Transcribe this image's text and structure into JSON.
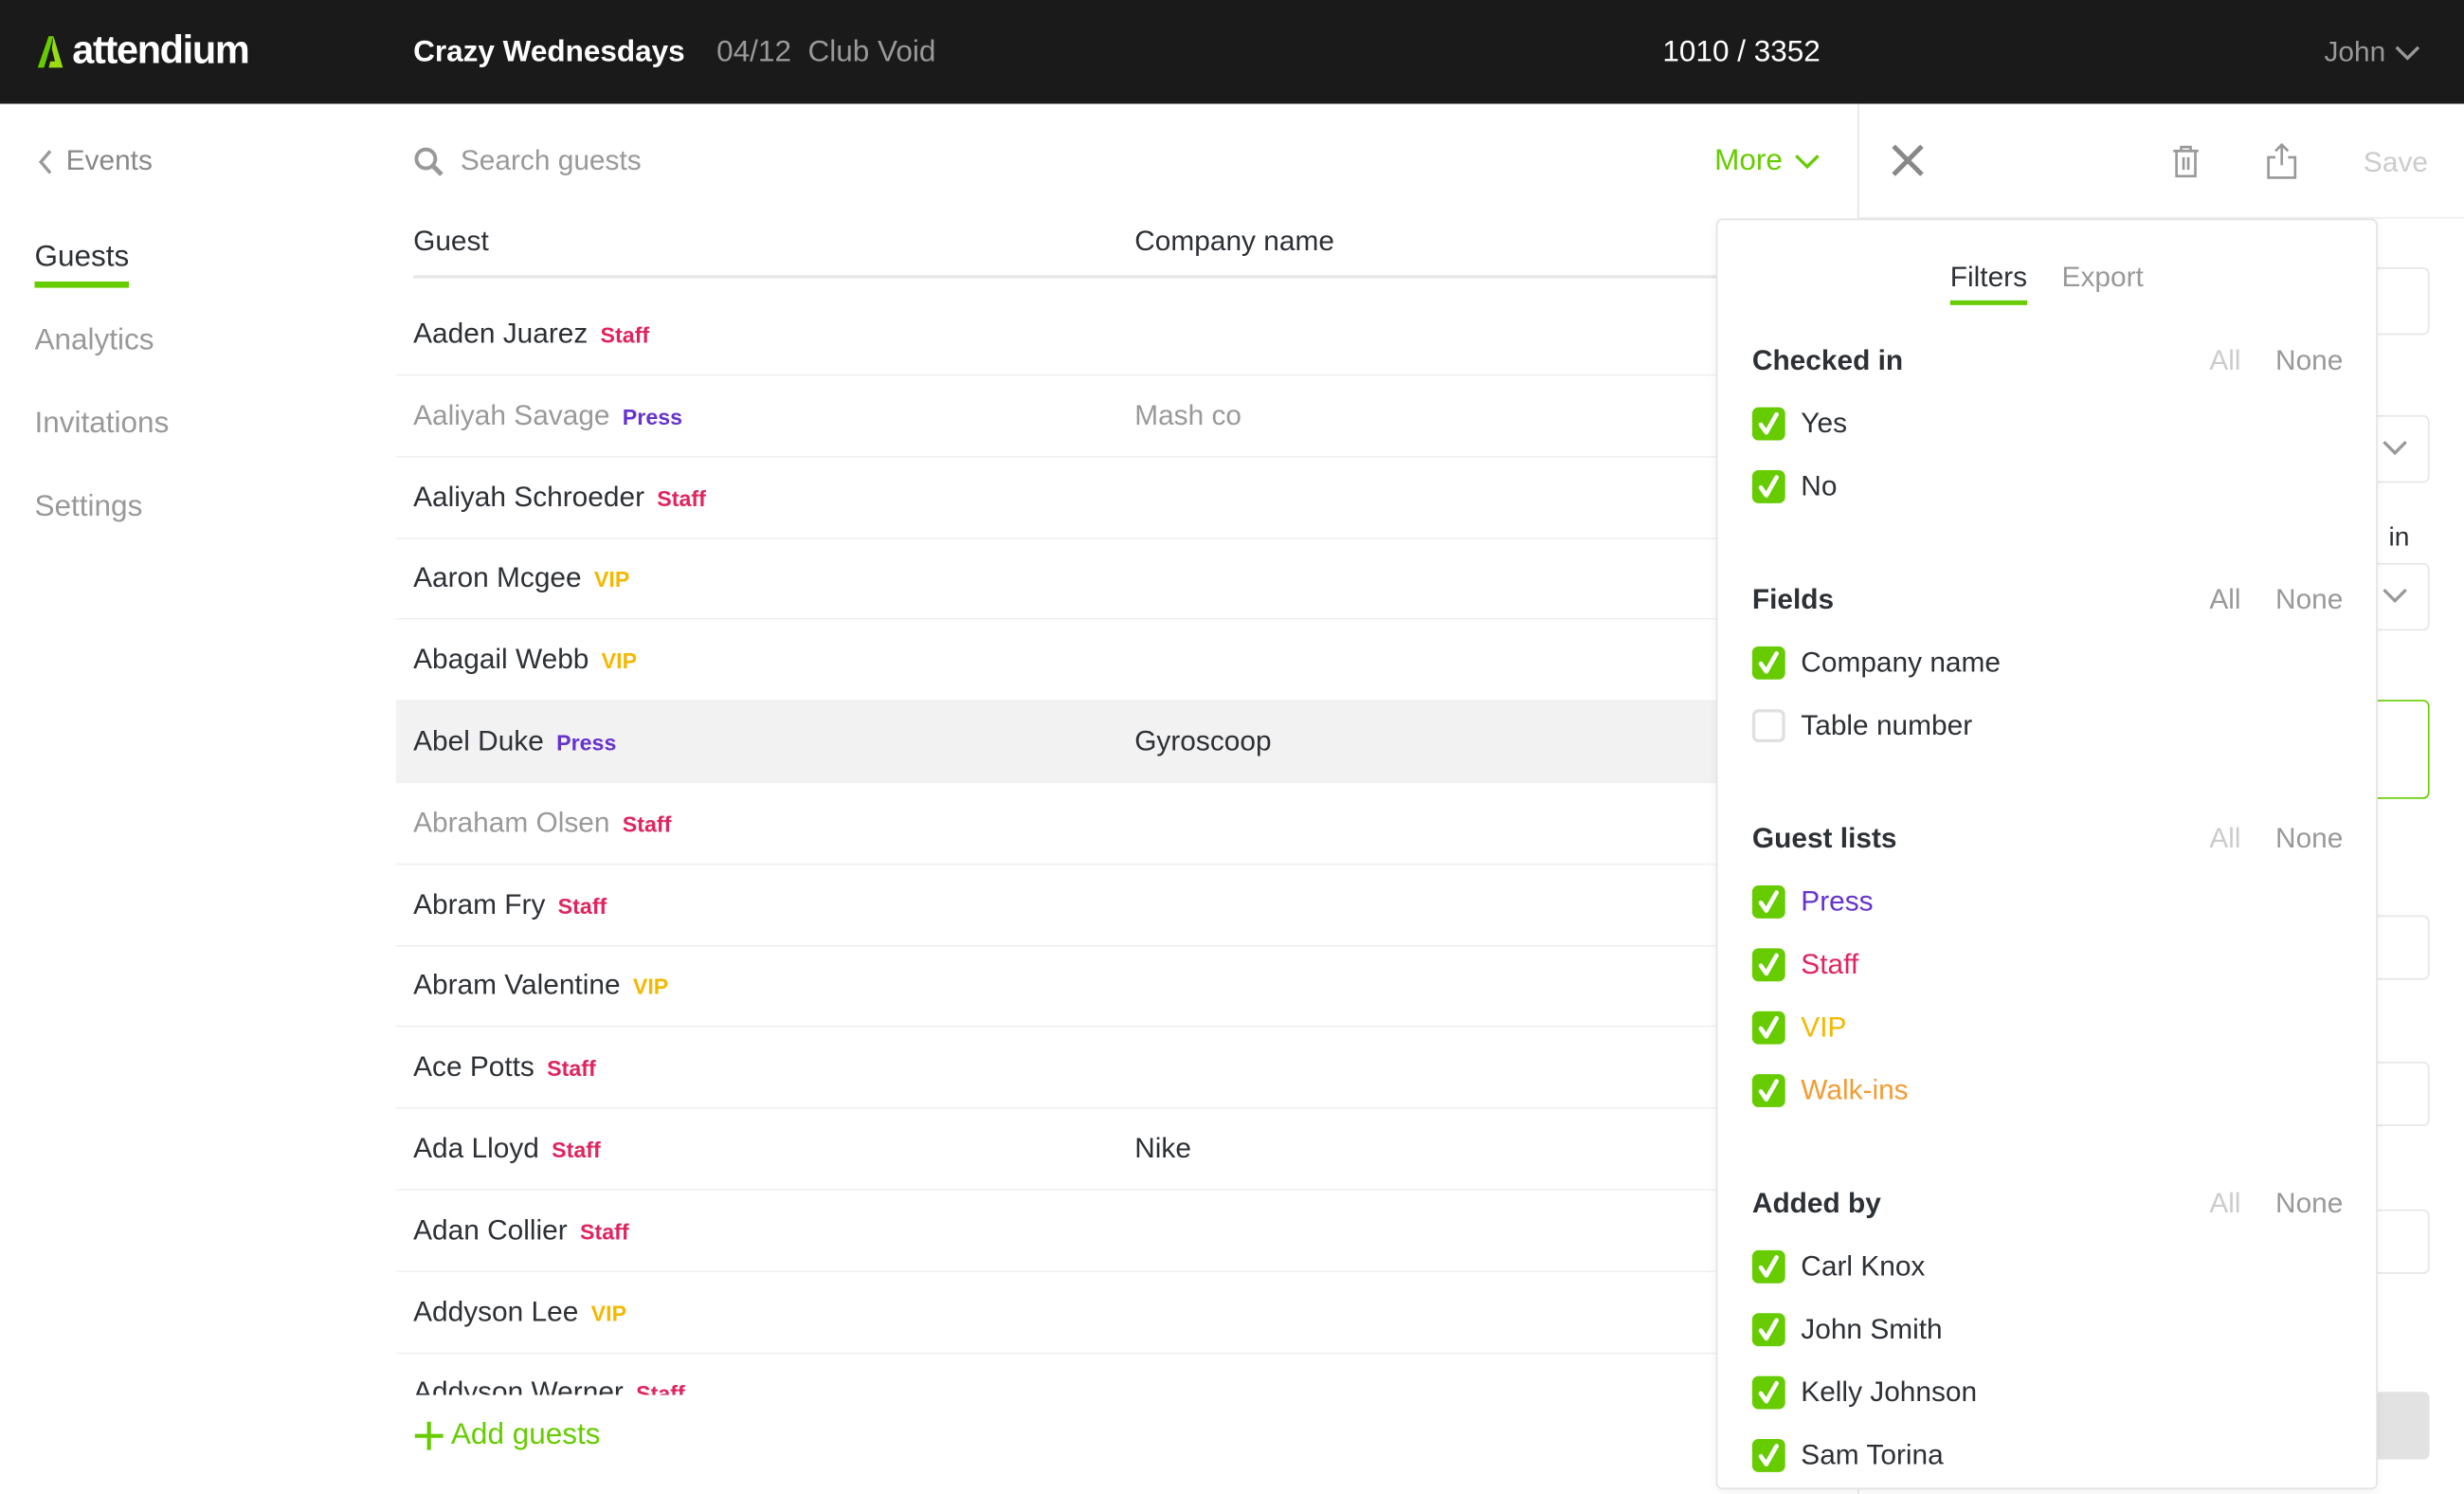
{
  "header": {
    "logo": "attendium",
    "event_name": "Crazy Wednesdays",
    "event_date": "04/12",
    "venue": "Club Void",
    "count": "1010 / 3352",
    "user": "John"
  },
  "sidebar": {
    "back": "Events",
    "items": [
      {
        "label": "Guests",
        "active": true
      },
      {
        "label": "Analytics"
      },
      {
        "label": "Invitations"
      },
      {
        "label": "Settings"
      }
    ]
  },
  "search": {
    "placeholder": "Search guests"
  },
  "more_label": "More",
  "columns": [
    "Guest",
    "Company name"
  ],
  "tag_colors": {
    "Staff": "#e0245e",
    "Press": "#6633cc",
    "VIP": "#f5b800",
    "Walk-ins": "#f39c33"
  },
  "accent": "#66cc00",
  "guests": [
    {
      "name": "Aaden Juarez",
      "tag": "Staff",
      "company": ""
    },
    {
      "name": "Aaliyah Savage",
      "tag": "Press",
      "company": "Mash co",
      "dim": true
    },
    {
      "name": "Aaliyah Schroeder",
      "tag": "Staff",
      "company": ""
    },
    {
      "name": "Aaron Mcgee",
      "tag": "VIP",
      "company": ""
    },
    {
      "name": "Abagail Webb",
      "tag": "VIP",
      "company": ""
    },
    {
      "name": "Abel Duke",
      "tag": "Press",
      "company": "Gyroscoop",
      "highlighted": true
    },
    {
      "name": "Abraham Olsen",
      "tag": "Staff",
      "company": "",
      "dim": true
    },
    {
      "name": "Abram Fry",
      "tag": "Staff",
      "company": ""
    },
    {
      "name": "Abram Valentine",
      "tag": "VIP",
      "company": ""
    },
    {
      "name": "Ace Potts",
      "tag": "Staff",
      "company": ""
    },
    {
      "name": "Ada Lloyd",
      "tag": "Staff",
      "company": "Nike"
    },
    {
      "name": "Adan Collier",
      "tag": "Staff",
      "company": ""
    },
    {
      "name": "Addyson Lee",
      "tag": "VIP",
      "company": ""
    },
    {
      "name": "Addyson Werner",
      "tag": "Staff",
      "company": ""
    }
  ],
  "add_guests": "Add guests",
  "detail": {
    "save": "Save",
    "partial_label": "in"
  },
  "popover": {
    "tabs": [
      {
        "label": "Filters",
        "active": true
      },
      {
        "label": "Export"
      }
    ],
    "all_label": "All",
    "none_label": "None",
    "sections": [
      {
        "title": "Checked in",
        "all_enabled": false,
        "options": [
          {
            "label": "Yes",
            "checked": true
          },
          {
            "label": "No",
            "checked": true
          }
        ]
      },
      {
        "title": "Fields",
        "all_enabled": true,
        "options": [
          {
            "label": "Company name",
            "checked": true
          },
          {
            "label": "Table number",
            "checked": false
          }
        ]
      },
      {
        "title": "Guest lists",
        "all_enabled": false,
        "options": [
          {
            "label": "Press",
            "checked": true,
            "color": "#6633cc"
          },
          {
            "label": "Staff",
            "checked": true,
            "color": "#e0245e"
          },
          {
            "label": "VIP",
            "checked": true,
            "color": "#f5b800"
          },
          {
            "label": "Walk-ins",
            "checked": true,
            "color": "#f39c33"
          }
        ]
      },
      {
        "title": "Added by",
        "all_enabled": false,
        "options": [
          {
            "label": "Carl Knox",
            "checked": true
          },
          {
            "label": "John Smith",
            "checked": true
          },
          {
            "label": "Kelly Johnson",
            "checked": true
          },
          {
            "label": "Sam Torina",
            "checked": true
          }
        ]
      }
    ]
  }
}
